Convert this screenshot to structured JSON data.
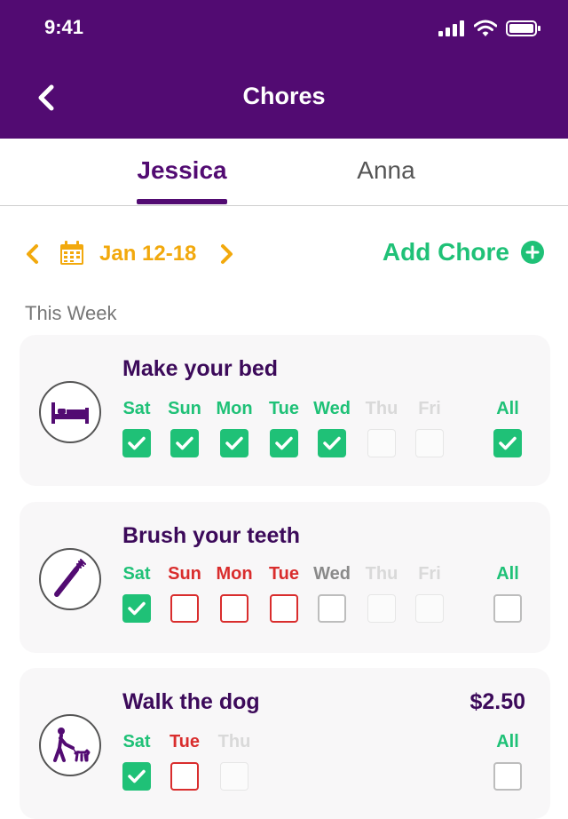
{
  "status": {
    "time": "9:41"
  },
  "header": {
    "title": "Chores"
  },
  "tabs": [
    {
      "label": "Jessica",
      "active": true
    },
    {
      "label": "Anna",
      "active": false
    }
  ],
  "week": {
    "range": "Jan 12-18",
    "add_chore_label": "Add Chore"
  },
  "section_label": "This Week",
  "colors": {
    "header": "#520b72",
    "green": "#1fc177",
    "red": "#d92d2d",
    "yellow": "#f2a90d",
    "gray": "#8a8a8a",
    "faint": "#d9d9d9",
    "title": "#3c0a5a"
  },
  "chores": [
    {
      "title": "Make your bed",
      "icon": "bed-icon",
      "price": "",
      "days": [
        {
          "label": "Sat",
          "state": "checked"
        },
        {
          "label": "Sun",
          "state": "checked"
        },
        {
          "label": "Mon",
          "state": "checked"
        },
        {
          "label": "Tue",
          "state": "checked"
        },
        {
          "label": "Wed",
          "state": "checked"
        },
        {
          "label": "Thu",
          "state": "future"
        },
        {
          "label": "Fri",
          "state": "future"
        }
      ],
      "all": {
        "label": "All",
        "state": "checked"
      }
    },
    {
      "title": "Brush your teeth",
      "icon": "toothbrush-icon",
      "price": "",
      "days": [
        {
          "label": "Sat",
          "state": "checked"
        },
        {
          "label": "Sun",
          "state": "missed"
        },
        {
          "label": "Mon",
          "state": "missed"
        },
        {
          "label": "Tue",
          "state": "missed"
        },
        {
          "label": "Wed",
          "state": "today"
        },
        {
          "label": "Thu",
          "state": "future"
        },
        {
          "label": "Fri",
          "state": "future"
        }
      ],
      "all": {
        "label": "All",
        "state": "unchecked"
      }
    },
    {
      "title": "Walk the dog",
      "icon": "dog-walk-icon",
      "price": "$2.50",
      "days": [
        {
          "label": "Sat",
          "state": "checked"
        },
        {
          "label": "Tue",
          "state": "missed"
        },
        {
          "label": "Thu",
          "state": "future"
        }
      ],
      "all": {
        "label": "All",
        "state": "unchecked"
      }
    }
  ]
}
